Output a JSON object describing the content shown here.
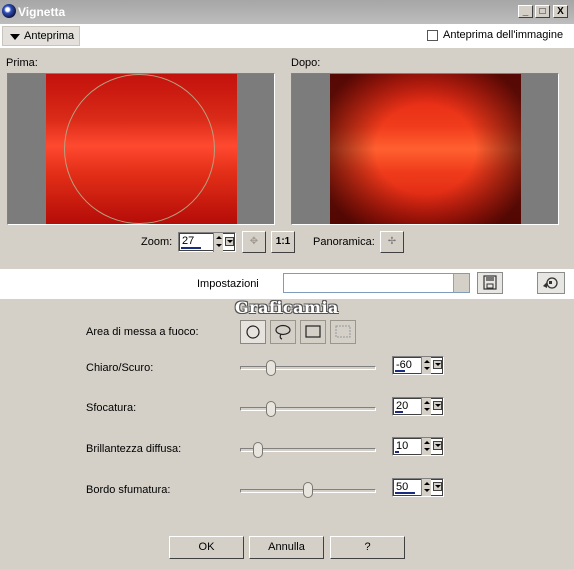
{
  "window": {
    "title": "Vignetta",
    "buttons": [
      "_",
      "□",
      "X"
    ]
  },
  "preview_toggle": {
    "label": "Anteprima"
  },
  "preview_checkbox": {
    "label": "Anteprima dell'immagine",
    "checked": false
  },
  "panes": {
    "before_label": "Prima:",
    "after_label": "Dopo:"
  },
  "zoom": {
    "label": "Zoom:",
    "value": "27",
    "one_to_one": "1:1"
  },
  "pan": {
    "label": "Panoramica:"
  },
  "settings": {
    "label": "Impostazioni",
    "preset_value": ""
  },
  "watermark": "Graficamia",
  "focus_area": {
    "label": "Area di messa a fuoco:",
    "shapes": [
      "circle",
      "lasso",
      "rectangle",
      "selection"
    ],
    "selected": "circle"
  },
  "sliders": {
    "brightness": {
      "label": "Chiaro/Scuro:",
      "value": "-60"
    },
    "blur": {
      "label": "Sfocatura:",
      "value": "20"
    },
    "glow": {
      "label": "Brillantezza diffusa:",
      "value": "10"
    },
    "feather": {
      "label": "Bordo sfumatura:",
      "value": "50"
    }
  },
  "footer": {
    "ok": "OK",
    "cancel": "Annulla",
    "help": "?"
  },
  "colors": {
    "titlebar": "#a6a6a6",
    "dialog": "#d4d0c8",
    "accent": "#1a2c80"
  }
}
